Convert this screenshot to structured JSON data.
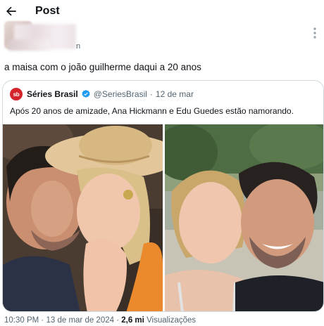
{
  "header": {
    "title": "Post",
    "back_icon": "arrow-left-icon"
  },
  "author": {
    "handle_tail": "n",
    "more_icon": "more-vertical-icon"
  },
  "tweet": {
    "text": "a maisa com o joão guilherme daqui a 20 anos"
  },
  "quote": {
    "logo_text": "sb",
    "name": "Séries Brasil",
    "verified_icon": "verified-badge-icon",
    "handle": "@SeriesBrasil",
    "separator": "·",
    "date": "12 de mar",
    "text": "Após 20 anos de amizade, Ana Hickmann e Edu Guedes estão namorando.",
    "brand_color": "#d4232a",
    "verified_color": "#1d9bf0"
  },
  "footer": {
    "time": "10:30 PM",
    "separator1": " · ",
    "date": "13 de mar de 2024",
    "separator2": " · ",
    "views_count": "2,6 mi",
    "views_label": "Visualizações"
  }
}
